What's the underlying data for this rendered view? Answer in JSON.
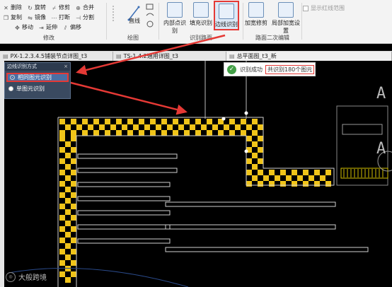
{
  "ribbon": {
    "modify": {
      "title": "修改",
      "items": [
        {
          "label": "删除",
          "icon": "x-icon"
        },
        {
          "label": "旋转",
          "icon": "rotate-icon"
        },
        {
          "label": "修剪",
          "icon": "trim-icon"
        },
        {
          "label": "合并",
          "icon": "merge-icon"
        },
        {
          "label": "复制",
          "icon": "copy-icon"
        },
        {
          "label": "镜像",
          "icon": "mirror-icon"
        },
        {
          "label": "打断",
          "icon": "break-icon"
        },
        {
          "label": "分割",
          "icon": "split-icon"
        },
        {
          "label": "移动",
          "icon": "move-icon"
        },
        {
          "label": "延伸",
          "icon": "extend-icon"
        },
        {
          "label": "偏移",
          "icon": "offset-icon"
        }
      ]
    },
    "draw": {
      "title": "绘图",
      "line_label": "直线"
    },
    "recognize": {
      "title": "识别路面",
      "buttons": [
        "内部点识别",
        "填充识别",
        "边线识别"
      ]
    },
    "edit2": {
      "title": "路面二次编辑",
      "buttons": [
        "加宽修剪",
        "局部加宽设置"
      ]
    },
    "show_redline": "显示红线范围"
  },
  "tabs": [
    {
      "label": "PX-1.2.3.4.5铺装节点详图_t3"
    },
    {
      "label": "TS-1.4.2通用详图_t3"
    },
    {
      "label": "总平面图_t3_新"
    }
  ],
  "panel": {
    "title": "边线识别方式",
    "close": "×",
    "options": [
      {
        "label": "相同图元识别",
        "selected": true
      },
      {
        "label": "单图元识别",
        "selected": false
      }
    ]
  },
  "toast": {
    "message": "识别成功",
    "count": "共识别180个图元"
  },
  "watermark": "大般跨境",
  "canvas_chars": [
    "A",
    "A"
  ],
  "colors": {
    "accent_red": "#e53935",
    "paving_yellow": "#f0c419",
    "panel_bg": "#3a4a60"
  }
}
